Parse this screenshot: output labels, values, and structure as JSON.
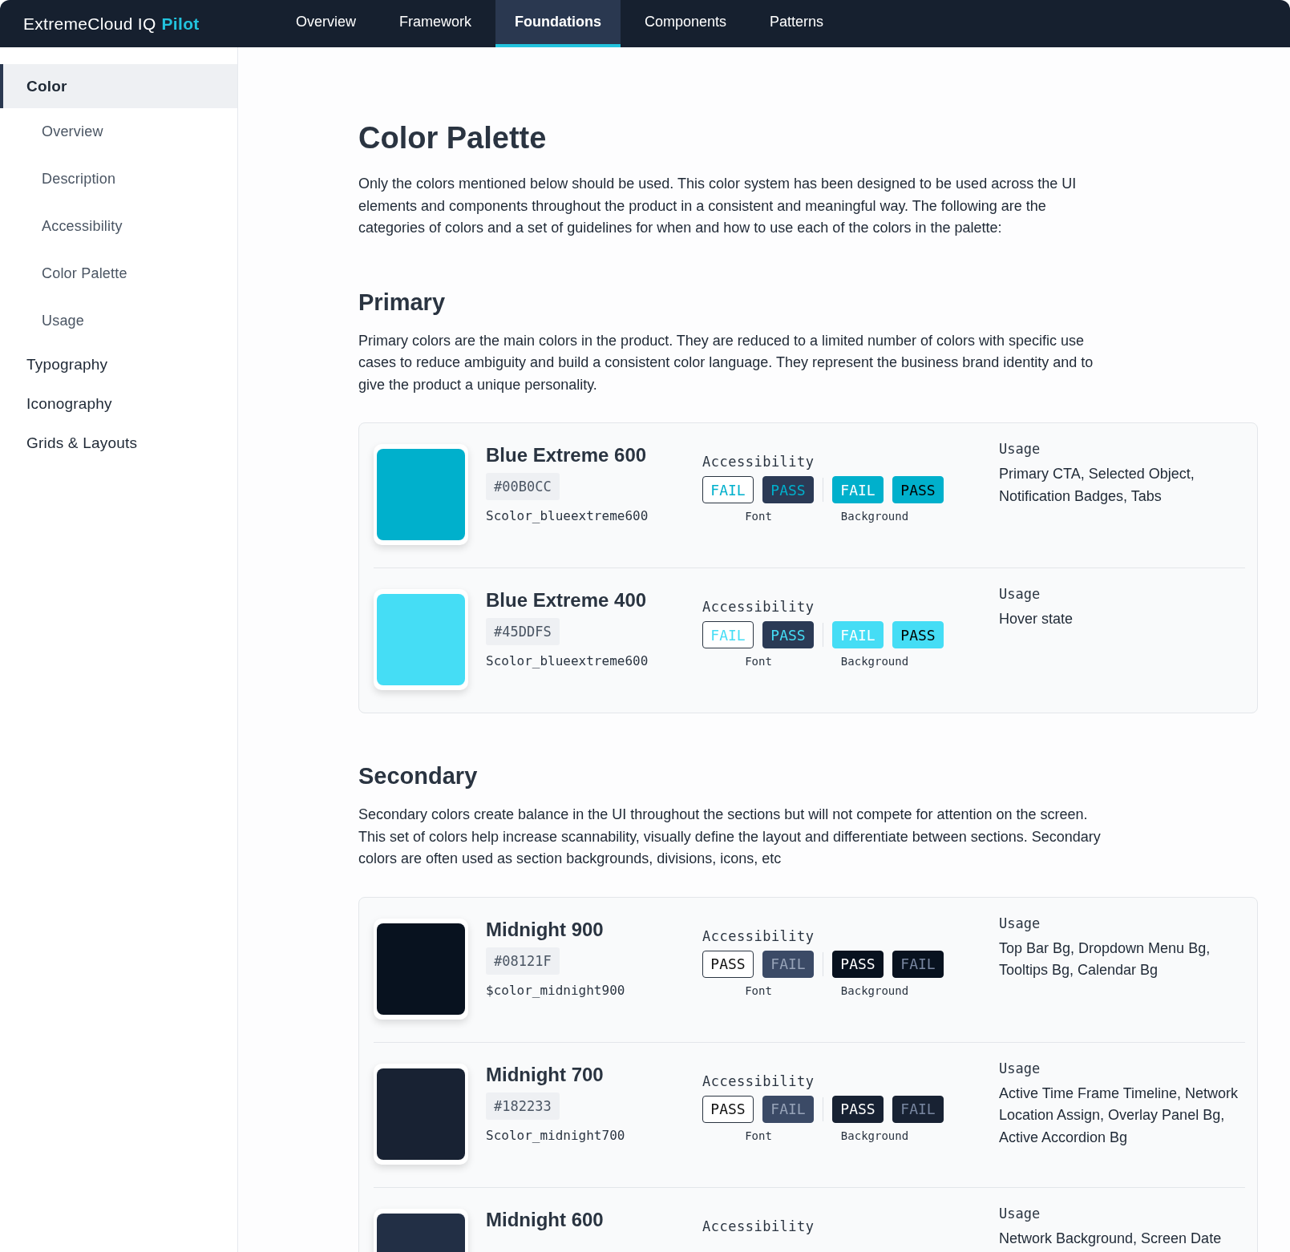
{
  "topbar": {
    "logo": {
      "name": "ExtremeCloud IQ",
      "highlight": "Pilot"
    },
    "tabs": [
      {
        "label": "Overview",
        "selected": false
      },
      {
        "label": "Framework",
        "selected": false
      },
      {
        "label": "Foundations",
        "selected": true
      },
      {
        "label": "Components",
        "selected": false
      },
      {
        "label": "Patterns",
        "selected": false
      }
    ]
  },
  "sidebar": {
    "items": [
      {
        "label": "Color",
        "selected": true,
        "children": [
          {
            "label": "Overview",
            "selected": false
          },
          {
            "label": "Description",
            "selected": false
          },
          {
            "label": "Accessibility",
            "selected": false
          },
          {
            "label": "Color Palette",
            "selected": false
          },
          {
            "label": "Usage",
            "selected": false
          }
        ]
      },
      {
        "label": "Typography",
        "selected": false
      },
      {
        "label": "Iconography",
        "selected": false
      },
      {
        "label": "Grids & Layouts",
        "selected": false
      }
    ]
  },
  "content": {
    "title": "Color Palette",
    "intro": "Only the colors mentioned below should be used. This color system has been designed to be used across the UI elements and components throughout the product in a consistent and meaningful way. The following are the categories of colors and a set of guidelines for when and how to use each of the colors in the palette:",
    "sections": [
      {
        "heading": "Primary",
        "description": "Primary colors are the main colors in the product. They are reduced to a limited number of colors with specific use cases to reduce ambiguity and build a consistent color language. They represent the business brand identity and to give the product a unique personality.",
        "colors": [
          {
            "name": "Blue Extreme 600",
            "color": "#00b0cc",
            "hex": "#00B0CC",
            "variable": "Scolor_blueextreme600",
            "accessibility_label": "Accessibility",
            "badges": [
              {
                "label": "FAIL",
                "kind": "outline"
              },
              {
                "label": "PASS",
                "kind": "dark"
              },
              {
                "label": "FAIL",
                "kind": "fill-light"
              },
              {
                "label": "PASS",
                "kind": "fill-dark"
              }
            ],
            "font_label": "Font",
            "background_label": "Background",
            "usage_label": "Usage",
            "usage": "Primary CTA, Selected Object, Notification Badges, Tabs"
          },
          {
            "name": "Blue Extreme 400",
            "color": "#45ddf5",
            "hex": "#45DDFS",
            "variable": "Scolor_blueextreme600",
            "accessibility_label": "Accessibility",
            "badges": [
              {
                "label": "FAIL",
                "kind": "outline"
              },
              {
                "label": "PASS",
                "kind": "dark"
              },
              {
                "label": "FAIL",
                "kind": "fill-light"
              },
              {
                "label": "PASS",
                "kind": "fill-dark"
              }
            ],
            "font_label": "Font",
            "background_label": "Background",
            "usage_label": "Usage",
            "usage": "Hover state"
          }
        ]
      },
      {
        "heading": "Secondary",
        "description": "Secondary colors create balance in the UI throughout the sections but will not compete for attention on the screen. This set of colors help increase scannability, visually define the layout and differentiate between sections. Secondary colors are often used as section backgrounds, divisions, icons, etc",
        "colors": [
          {
            "name": "Midnight 900",
            "color": "#08121f",
            "hex": "#08121F",
            "variable": "$color_midnight900",
            "accessibility_label": "Accessibility",
            "badges": [
              {
                "label": "PASS",
                "kind": "outline"
              },
              {
                "label": "FAIL",
                "kind": "dark"
              },
              {
                "label": "PASS",
                "kind": "fill-light"
              },
              {
                "label": "FAIL",
                "kind": "fill-dark"
              }
            ],
            "font_label": "Font",
            "background_label": "Background",
            "usage_label": "Usage",
            "usage": "Top Bar Bg, Dropdown Menu Bg, Tooltips Bg, Calendar Bg"
          },
          {
            "name": "Midnight 700",
            "color": "#182233",
            "hex": "#182233",
            "variable": "Scolor_midnight700",
            "accessibility_label": "Accessibility",
            "badges": [
              {
                "label": "PASS",
                "kind": "outline"
              },
              {
                "label": "FAIL",
                "kind": "dark"
              },
              {
                "label": "PASS",
                "kind": "fill-light"
              },
              {
                "label": "FAIL",
                "kind": "fill-dark"
              }
            ],
            "font_label": "Font",
            "background_label": "Background",
            "usage_label": "Usage",
            "usage": "Active Time Frame Timeline, Network Location Assign, Overlay Panel Bg, Active Accordion Bg"
          },
          {
            "name": "Midnight 600",
            "color": "#222f45",
            "accessibility_label": "Accessibility",
            "usage_label": "Usage",
            "usage": "Network Background, Screen Date"
          }
        ]
      }
    ]
  }
}
